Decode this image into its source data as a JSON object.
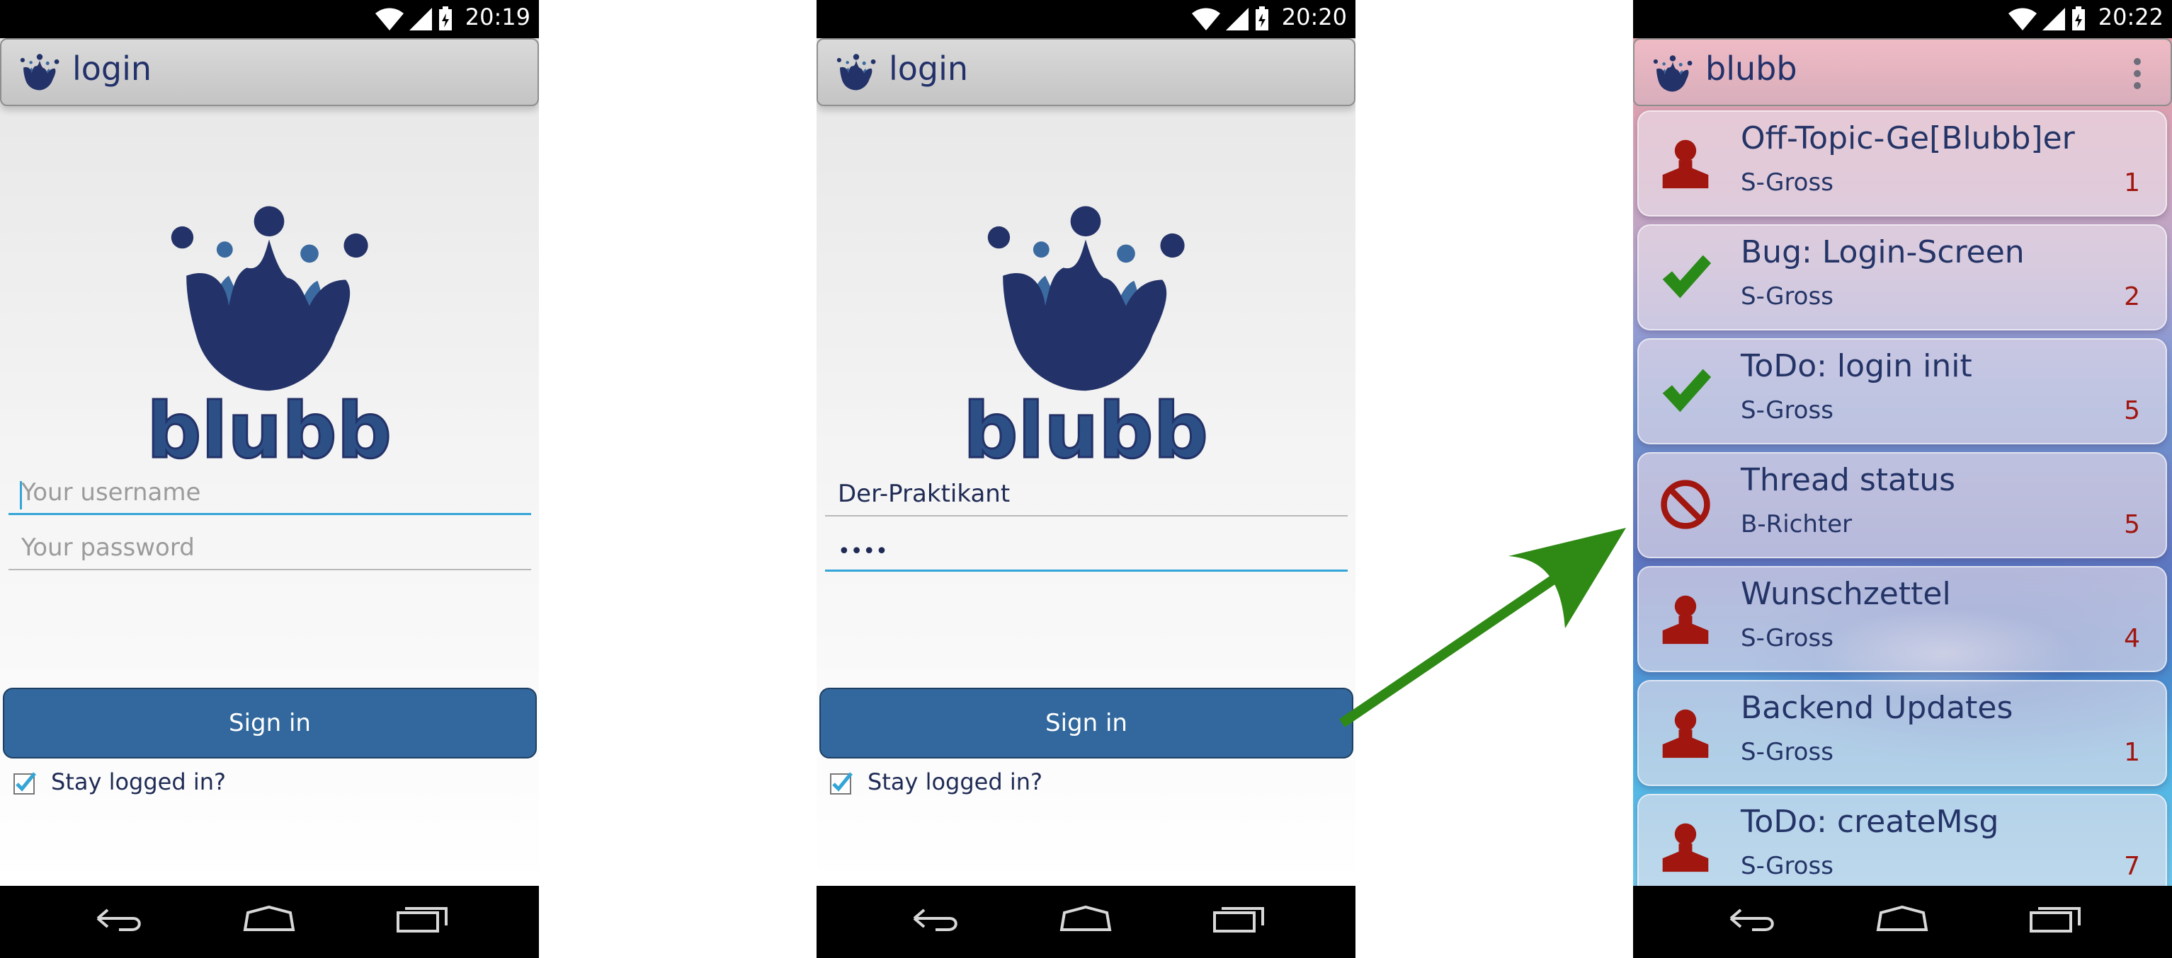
{
  "screens": {
    "login_empty": {
      "status_time": "20:19",
      "action_title": "login",
      "username_placeholder": "Your username",
      "password_placeholder": "Your password",
      "signin_label": "Sign in",
      "stay_logged_label": "Stay logged in?"
    },
    "login_filled": {
      "status_time": "20:20",
      "action_title": "login",
      "username_value": "Der-Praktikant",
      "password_value": "••••",
      "signin_label": "Sign in",
      "stay_logged_label": "Stay logged in?"
    },
    "thread_list": {
      "status_time": "20:22",
      "action_title": "blubb",
      "threads": [
        {
          "title": "Off-Topic-Ge[Blubb]er",
          "author": "S-Gross",
          "count": "1",
          "icon": "user-icon"
        },
        {
          "title": "Bug: Login-Screen",
          "author": "S-Gross",
          "count": "2",
          "icon": "checkmark-icon"
        },
        {
          "title": "ToDo: login init",
          "author": "S-Gross",
          "count": "5",
          "icon": "checkmark-icon"
        },
        {
          "title": "Thread status",
          "author": "B-Richter",
          "count": "5",
          "icon": "blocked-icon"
        },
        {
          "title": "Wunschzettel",
          "author": "S-Gross",
          "count": "4",
          "icon": "user-icon"
        },
        {
          "title": "Backend Updates",
          "author": "S-Gross",
          "count": "1",
          "icon": "user-icon"
        },
        {
          "title": "ToDo: createMsg",
          "author": "S-Gross",
          "count": "7",
          "icon": "user-icon"
        }
      ]
    }
  },
  "logo_text": "blubb",
  "colors": {
    "brand_dark": "#233268",
    "brand_mid": "#32689d",
    "accent": "#33a5d7",
    "count_red": "#a1160f",
    "check_green": "#2a8a17",
    "arrow_green": "#2f8a15"
  }
}
